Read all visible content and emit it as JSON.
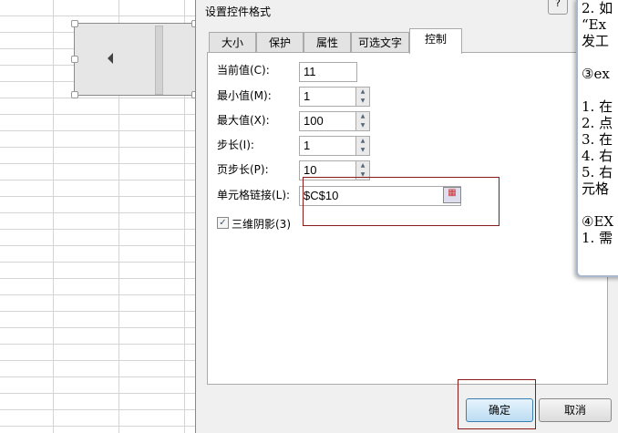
{
  "dialog": {
    "title": "设置控件格式",
    "help": "?",
    "tabs": [
      "大小",
      "保护",
      "属性",
      "可选文字",
      "控制"
    ],
    "fields": {
      "current_label": "当前值(C):",
      "current_value": "11",
      "min_label": "最小值(M):",
      "min_value": "1",
      "max_label": "最大值(X):",
      "max_value": "100",
      "step_label": "步长(I):",
      "step_value": "1",
      "page_label": "页步长(P):",
      "page_value": "10",
      "link_label": "单元格链接(L):",
      "link_value": "$C$10",
      "shading_label": "三维阴影(3)"
    },
    "ok": "确定",
    "cancel": "取消"
  },
  "notepad": {
    "lines": [
      "2. 如",
      "“Ex",
      "发工",
      "",
      "③ex",
      "",
      "1. 在",
      "2. 点",
      "3. 在",
      "4. 右",
      "5. 右",
      "元格",
      "",
      "④EX",
      "1. 需"
    ]
  }
}
